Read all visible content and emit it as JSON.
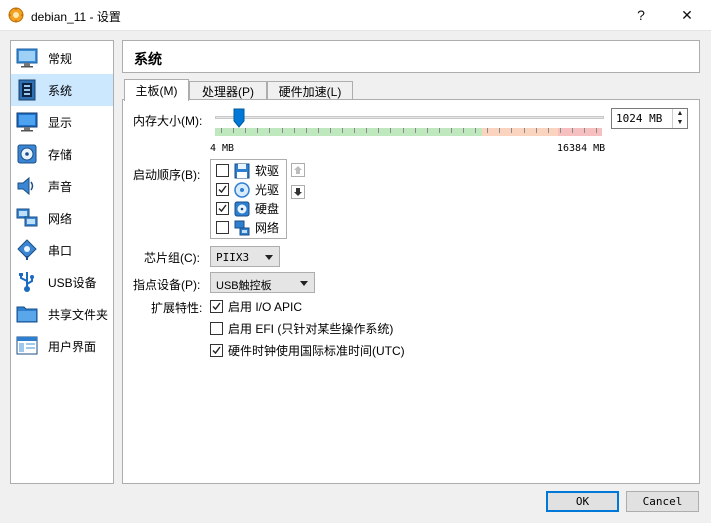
{
  "window": {
    "title": "debian_11 - 设置",
    "help_glyph": "?",
    "close_glyph": "✕"
  },
  "sidebar": {
    "items": [
      {
        "label": "常规",
        "icon": "general-icon"
      },
      {
        "label": "系统",
        "icon": "system-icon",
        "selected": true
      },
      {
        "label": "显示",
        "icon": "display-icon"
      },
      {
        "label": "存储",
        "icon": "storage-icon"
      },
      {
        "label": "声音",
        "icon": "audio-icon"
      },
      {
        "label": "网络",
        "icon": "network-icon"
      },
      {
        "label": "串口",
        "icon": "serial-port-icon"
      },
      {
        "label": "USB设备",
        "icon": "usb-icon"
      },
      {
        "label": "共享文件夹",
        "icon": "shared-folder-icon"
      },
      {
        "label": "用户界面",
        "icon": "user-interface-icon"
      }
    ]
  },
  "page": {
    "title": "系统"
  },
  "tabs": [
    {
      "label": "主板(M)",
      "active": true
    },
    {
      "label": "处理器(P)"
    },
    {
      "label": "硬件加速(L)"
    }
  ],
  "motherboard": {
    "memory_label": "内存大小(M):",
    "memory_value": "1024 MB",
    "memory_fraction": 0.0625,
    "memory_min_label": "4 MB",
    "memory_max_label": "16384 MB",
    "boot_order_label": "启动顺序(B):",
    "boot_items": [
      {
        "label": "软驱",
        "checked": false,
        "icon": "floppy-icon"
      },
      {
        "label": "光驱",
        "checked": true,
        "icon": "optical-drive-icon"
      },
      {
        "label": "硬盘",
        "checked": true,
        "icon": "hard-disk-icon"
      },
      {
        "label": "网络",
        "checked": false,
        "icon": "network-icon"
      }
    ],
    "chipset_label": "芯片组(C):",
    "chipset_value": "PIIX3",
    "pointing_label": "指点设备(P):",
    "pointing_value": "USB触控板",
    "features_label": "扩展特性:",
    "features": [
      {
        "label": "启用 I/O APIC",
        "checked": true
      },
      {
        "label": "启用 EFI (只针对某些操作系统)",
        "checked": false
      },
      {
        "label": "硬件时钟使用国际标准时间(UTC)",
        "checked": true
      }
    ]
  },
  "buttons": {
    "ok": "OK",
    "cancel": "Cancel"
  },
  "colors": {
    "selection": "#cce8ff",
    "accent": "#0078d7"
  }
}
